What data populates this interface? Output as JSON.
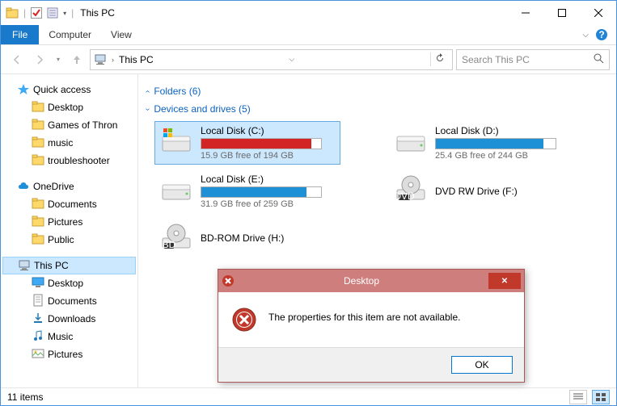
{
  "window": {
    "title": "This PC"
  },
  "ribbon": {
    "file": "File",
    "computer": "Computer",
    "view": "View"
  },
  "address": {
    "location": "This PC"
  },
  "search": {
    "placeholder": "Search This PC"
  },
  "sidebar": {
    "quick_access": "Quick access",
    "qa_items": [
      "Desktop",
      "Games of Thron",
      "music",
      "troubleshooter"
    ],
    "onedrive": "OneDrive",
    "od_items": [
      "Documents",
      "Pictures",
      "Public"
    ],
    "this_pc": "This PC",
    "pc_items": [
      "Desktop",
      "Documents",
      "Downloads",
      "Music",
      "Pictures"
    ]
  },
  "groups": {
    "folders": "Folders (6)",
    "devices": "Devices and drives (5)"
  },
  "drives": [
    {
      "name": "Local Disk (C:)",
      "free": "15.9 GB free of 194 GB",
      "used_pct": 92,
      "color": "#d22424",
      "has_bar": true,
      "icon": "os"
    },
    {
      "name": "Local Disk (D:)",
      "free": "25.4 GB free of 244 GB",
      "used_pct": 90,
      "color": "#1e90d6",
      "has_bar": true,
      "icon": "hdd"
    },
    {
      "name": "Local Disk (E:)",
      "free": "31.9 GB free of 259 GB",
      "used_pct": 88,
      "color": "#1e90d6",
      "has_bar": true,
      "icon": "hdd"
    },
    {
      "name": "DVD RW Drive (F:)",
      "free": "",
      "used_pct": 0,
      "color": "",
      "has_bar": false,
      "icon": "dvd"
    },
    {
      "name": "BD-ROM Drive (H:)",
      "free": "",
      "used_pct": 0,
      "color": "",
      "has_bar": false,
      "icon": "bd"
    }
  ],
  "status": {
    "items": "11 items"
  },
  "dialog": {
    "title": "Desktop",
    "message": "The properties for this item are not available.",
    "ok": "OK"
  }
}
